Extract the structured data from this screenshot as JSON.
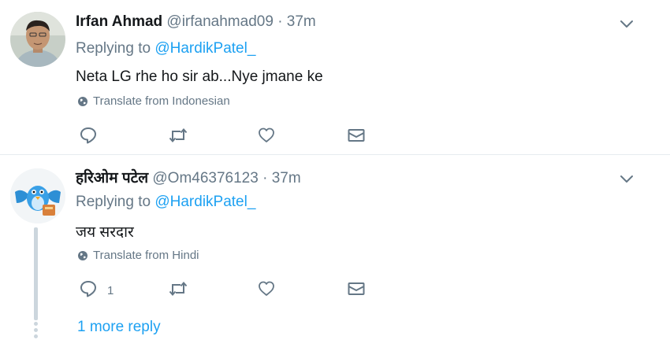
{
  "tweets": [
    {
      "name": "Irfan Ahmad",
      "handle": "@irfanahmad09",
      "separator": "·",
      "time": "37m",
      "replying_prefix": "Replying to",
      "replying_handle": "@HardikPatel_",
      "text": "Neta LG rhe ho sir ab...Nye jmane ke",
      "translate": "Translate from Indonesian",
      "reply_count": "",
      "avatar_icon": "person-photo"
    },
    {
      "name": "हरिओम पटेल",
      "handle": "@Om46376123",
      "separator": "·",
      "time": "37m",
      "replying_prefix": "Replying to",
      "replying_handle": "@HardikPatel_",
      "text": "जय सरदार",
      "translate": "Translate from Hindi",
      "reply_count": "1",
      "avatar_icon": "blue-bird-illustration"
    }
  ],
  "more_reply_label": "1 more reply",
  "colors": {
    "link": "#1da1f2",
    "secondary_text": "#657786",
    "primary_text": "#14171a",
    "thread_line": "#ccd6dd",
    "divider": "#e6ecf0"
  }
}
